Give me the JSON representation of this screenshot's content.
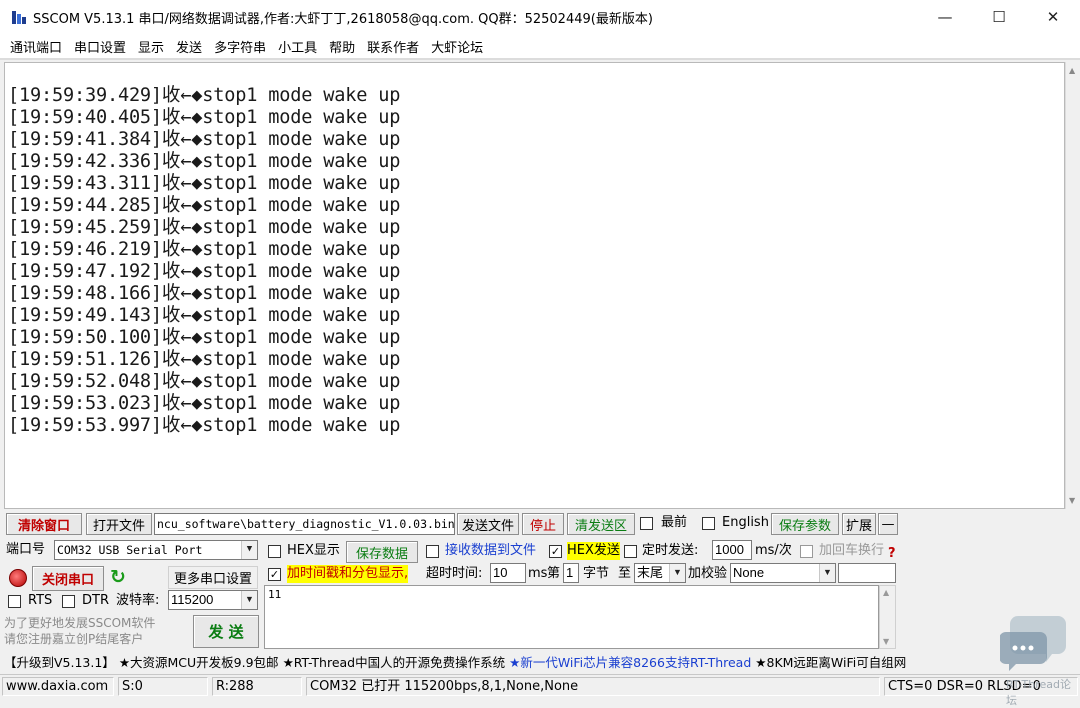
{
  "window": {
    "title": "SSCOM V5.13.1 串口/网络数据调试器,作者:大虾丁丁,2618058@qq.com. QQ群：52502449(最新版本)",
    "minimize": "—",
    "maximize": "☐",
    "close": "✕"
  },
  "menu": [
    "通讯端口",
    "串口设置",
    "显示",
    "发送",
    "多字符串",
    "小工具",
    "帮助",
    "联系作者",
    "大虾论坛"
  ],
  "receive": {
    "lines": [
      "[19:59:39.429]收←◆stop1 mode wake up",
      "[19:59:40.405]收←◆stop1 mode wake up",
      "[19:59:41.384]收←◆stop1 mode wake up",
      "[19:59:42.336]收←◆stop1 mode wake up",
      "[19:59:43.311]收←◆stop1 mode wake up",
      "[19:59:44.285]收←◆stop1 mode wake up",
      "[19:59:45.259]收←◆stop1 mode wake up",
      "[19:59:46.219]收←◆stop1 mode wake up",
      "[19:59:47.192]收←◆stop1 mode wake up",
      "[19:59:48.166]收←◆stop1 mode wake up",
      "[19:59:49.143]收←◆stop1 mode wake up",
      "[19:59:50.100]收←◆stop1 mode wake up",
      "[19:59:51.126]收←◆stop1 mode wake up",
      "[19:59:52.048]收←◆stop1 mode wake up",
      "[19:59:53.023]收←◆stop1 mode wake up",
      "[19:59:53.997]收←◆stop1 mode wake up"
    ]
  },
  "toolbar": {
    "clear_window": "清除窗口",
    "open_file": "打开文件",
    "file_path": "ncu_software\\battery_diagnostic_V1.0.03.bin",
    "send_file": "发送文件",
    "stop": "停止",
    "clear_send": "清发送区",
    "topmost": "最前",
    "english": "English",
    "save_params": "保存参数",
    "expand": "扩展",
    "collapse": "—"
  },
  "port": {
    "port_label": "端口号",
    "port_value": "COM32 USB Serial Port",
    "close_port": "关闭串口",
    "more_settings": "更多串口设置",
    "rts": "RTS",
    "dtr": "DTR",
    "baud_label": "波特率:",
    "baud_value": "115200",
    "promo": "为了更好地发展SSCOM软件\n请您注册嘉立创P结尾客户",
    "send": "发 送"
  },
  "options": {
    "hex_display": "HEX显示",
    "save_data": "保存数据",
    "recv_to_file": "接收数据到文件",
    "hex_send": "HEX发送",
    "timed_send": "定时发送:",
    "interval": "1000",
    "interval_unit": "ms/次",
    "add_crlf": "加回车换行",
    "timestamp": "加时间戳和分包显示,",
    "timeout_label": "超时时间:",
    "timeout_value": "10",
    "timeout_unit": "ms",
    "byte_prefix": "第",
    "byte_value": "1",
    "byte_suffix": "字节",
    "to": "至",
    "end_value": "末尾",
    "checksum_label": "加校验",
    "checksum_value": "None",
    "hex_display_checked": false,
    "recv_to_file_checked": false,
    "hex_send_checked": true,
    "timed_send_checked": false,
    "add_crlf_checked": false,
    "timestamp_checked": true,
    "topmost_checked": false,
    "english_checked": false
  },
  "send_area": {
    "value": "11"
  },
  "marquee": [
    {
      "text": "【升级到V5.13.1】",
      "color": "#000000"
    },
    {
      "text": "★大资源MCU开发板9.9包邮",
      "color": "#000000"
    },
    {
      "text": "★RT-Thread中国人的开源免费操作系统",
      "color": "#000000"
    },
    {
      "text": "★新一代WiFi芯片兼容8266支持RT-Thread",
      "color": "#1a3fd0"
    },
    {
      "text": "★8KM远距离WiFi可自组网",
      "color": "#000000"
    }
  ],
  "status": {
    "website": "www.daxia.com",
    "sent": "S:0",
    "received": "R:288",
    "port_info": "COM32 已打开  115200bps,8,1,None,None",
    "lines": "CTS=0 DSR=0 RLSD=0"
  },
  "watermark": {
    "text": "RT-Thread论坛"
  }
}
